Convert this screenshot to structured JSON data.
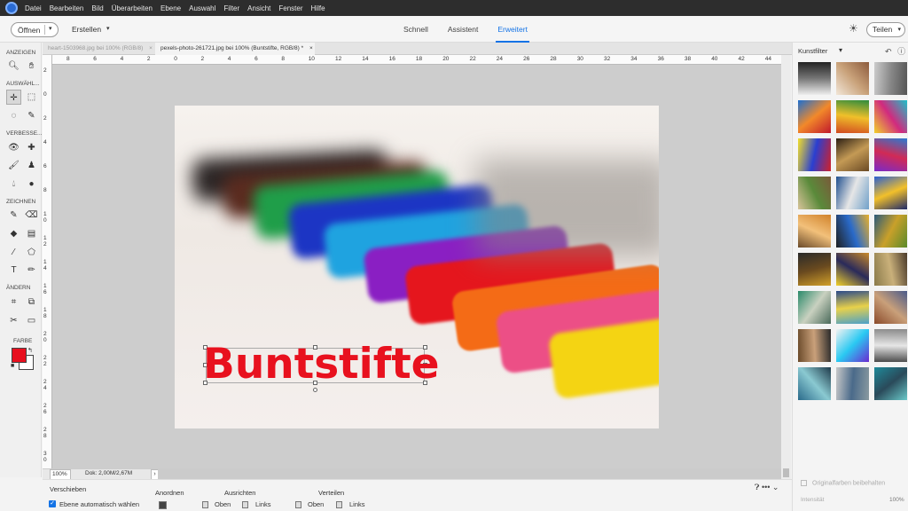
{
  "menubar": {
    "items": [
      "Datei",
      "Bearbeiten",
      "Bild",
      "Überarbeiten",
      "Ebene",
      "Auswahl",
      "Filter",
      "Ansicht",
      "Fenster",
      "Hilfe"
    ]
  },
  "topbar": {
    "open_label": "Öffnen",
    "create_label": "Erstellen",
    "modes": [
      "Schnell",
      "Assistent",
      "Erweitert"
    ],
    "active_mode": "Erweitert",
    "share_label": "Teilen",
    "caret": "▾"
  },
  "toolbar": {
    "sections": {
      "view": "ANZEIGEN",
      "select": "AUSWÄHL...",
      "enhance": "VERBESSE...",
      "draw": "ZEICHNEN",
      "modify": "ÄNDERN",
      "color": "FARBE"
    },
    "foreground_color": "#e8101f",
    "background_color": "#ffffff"
  },
  "doc_tabs": [
    {
      "label": "heart-1503968.jpg bei 100% (RGB/8)",
      "close": "×",
      "active": false
    },
    {
      "label": "pexels-photo-261721.jpg bei 100% (Buntstifte, RGB/8) *",
      "close": "×",
      "active": true
    }
  ],
  "ruler": {
    "h_labels": [
      "8",
      "6",
      "4",
      "2",
      "0",
      "2",
      "4",
      "6",
      "8",
      "10",
      "12",
      "14",
      "16",
      "18",
      "20",
      "22",
      "24",
      "26",
      "28",
      "30",
      "32",
      "34",
      "36",
      "38",
      "40",
      "42",
      "44"
    ],
    "v_labels": [
      "2",
      "0",
      "2",
      "4",
      "6",
      "8",
      "1\n0",
      "1\n2",
      "1\n4",
      "1\n6",
      "1\n8",
      "2\n0",
      "2\n2",
      "2\n4",
      "2\n6",
      "2\n8",
      "3\n0"
    ]
  },
  "canvas": {
    "text_layer": "Buntstifte",
    "text_color": "#e8111e"
  },
  "status": {
    "zoom": "100%",
    "doc_size": "Dok: 2,00M/2,67M",
    "arrow": "›"
  },
  "options_bar": {
    "tool_name": "Verschieben",
    "auto_select_label": "Ebene automatisch wählen",
    "arrange_label": "Anordnen",
    "align_label": "Ausrichten",
    "align_top": "Oben",
    "align_left": "Links",
    "distribute_label": "Verteilen",
    "distribute_top": "Oben",
    "distribute_left": "Links"
  },
  "panel": {
    "title": "Kunstfilter",
    "keep_colors_label": "Originalfarben beibehalten",
    "intensity_label": "Intensität",
    "intensity_value": "100%"
  }
}
